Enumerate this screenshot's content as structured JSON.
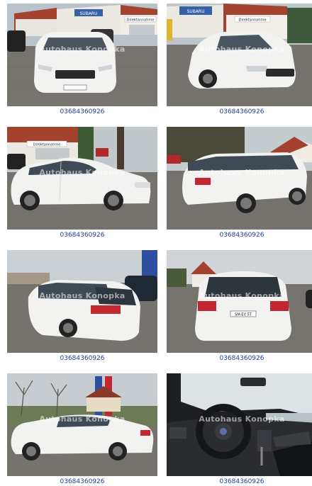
{
  "watermark": "Autohaus Konopka",
  "signs": {
    "brand": "SUBARU",
    "dealer": "Direktannahme"
  },
  "gallery": [
    {
      "phone": "03684360926"
    },
    {
      "phone": "03684360926"
    },
    {
      "phone": "03684360926"
    },
    {
      "phone": "03684360926"
    },
    {
      "phone": "03684360926"
    },
    {
      "phone": "03684360926"
    },
    {
      "phone": "03684360926"
    },
    {
      "phone": "03684360926"
    }
  ],
  "plate": "SM-EV 5T",
  "colors": {
    "link": "#1d3f8e",
    "car": "#f2f2f0",
    "pavement": "#6f6f6d",
    "roof": "#a3432f"
  }
}
